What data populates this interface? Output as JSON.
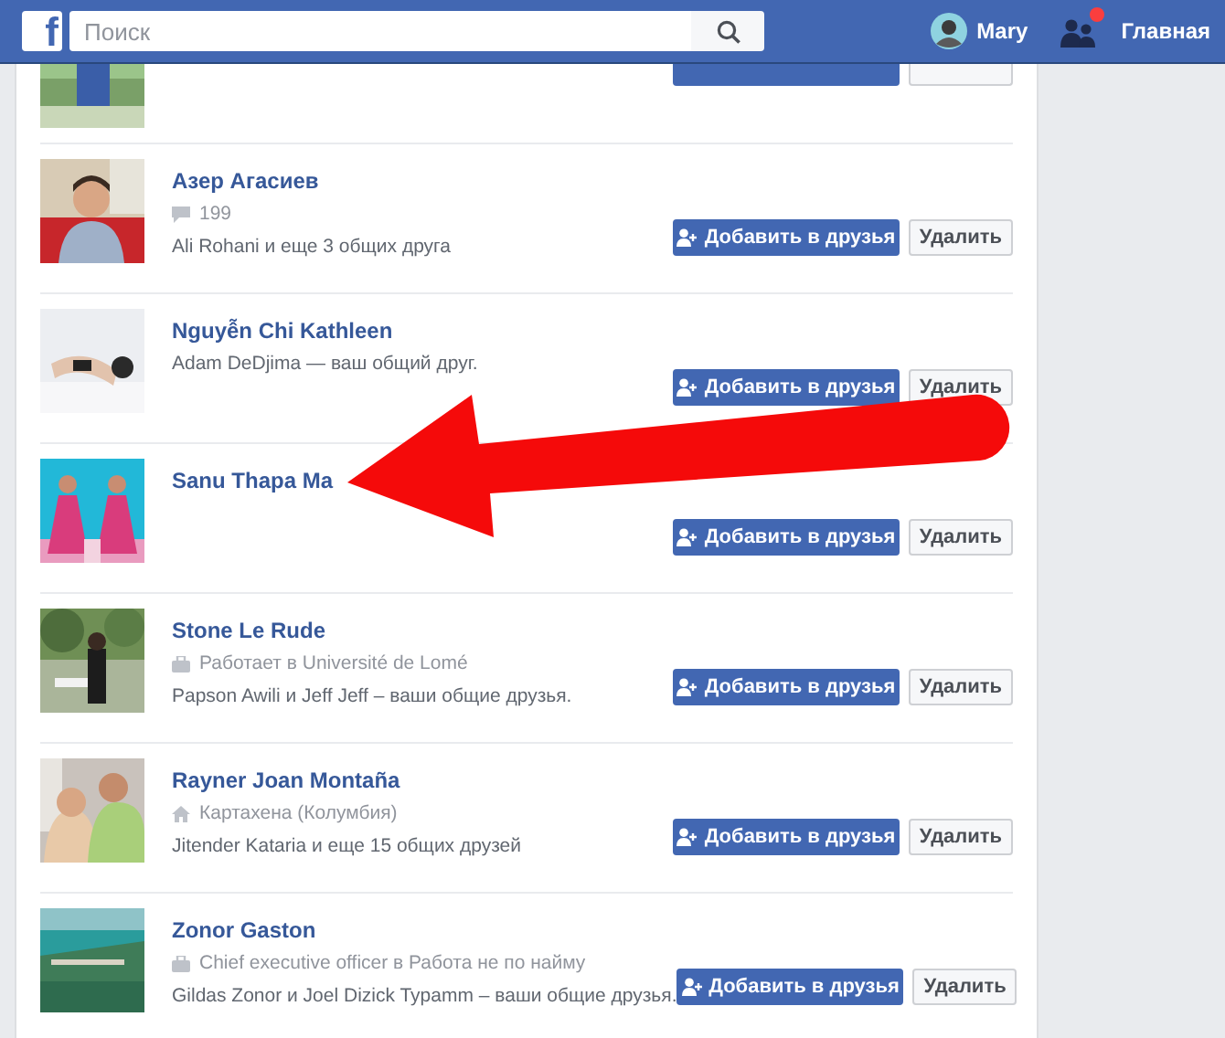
{
  "header": {
    "logo": "f",
    "search": {
      "placeholder": "Поиск"
    },
    "user": "Mary",
    "requests_badge": true,
    "home": "Главная"
  },
  "suggestions": [
    {
      "kind": "partial"
    },
    {
      "kind": "person",
      "name": "Азер Агасиев",
      "details": [
        {
          "kind": "comments",
          "text": "199"
        }
      ],
      "mutual": "Ali Rohani и еще 3 общих друга",
      "add": "Добавить в друзья",
      "remove": "Удалить"
    },
    {
      "kind": "person",
      "name": "Nguyễn Chi Kathleen",
      "mutual": "Adam DeDjima — ваш общий друг.",
      "add": "Добавить в друзья",
      "remove": "Удалить"
    },
    {
      "kind": "person",
      "name": "Sanu Thapa Ma",
      "add": "Добавить в друзья",
      "remove": "Удалить"
    },
    {
      "kind": "person",
      "name": "Stone Le Rude",
      "details": [
        {
          "kind": "work",
          "text": "Работает в Université de Lomé"
        }
      ],
      "mutual": "Papson Awili и Jeff Jeff – ваши общие друзья.",
      "add": "Добавить в друзья",
      "remove": "Удалить"
    },
    {
      "kind": "person",
      "name": "Rayner Joan Montaña",
      "details": [
        {
          "kind": "residence",
          "text": "Картахена (Колумбия)"
        }
      ],
      "mutual": "Jitender Kataria и еще 15 общих друзей",
      "add": "Добавить в друзья",
      "remove": "Удалить"
    },
    {
      "kind": "person",
      "name": "Zonor Gaston",
      "details": [
        {
          "kind": "work",
          "text": "Chief executive officer в Работа не по найму"
        }
      ],
      "mutual": "Gildas Zonor и Joel Dizick Typamm – ваши общие друзья.",
      "add": "Добавить в друзья",
      "remove": "Удалить"
    }
  ],
  "annotation": {
    "kind": "arrow"
  }
}
